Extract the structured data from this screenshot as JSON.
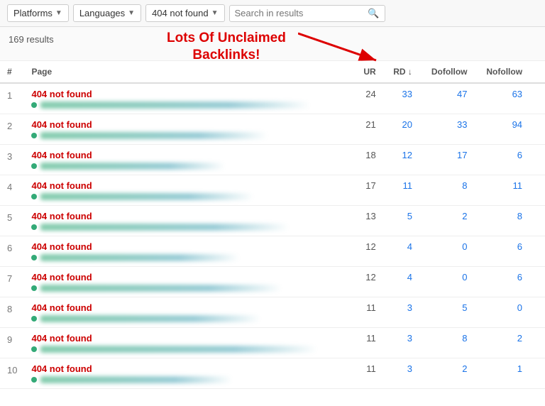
{
  "toolbar": {
    "platforms_label": "Platforms",
    "languages_label": "Languages",
    "filter_label": "404 not found",
    "search_placeholder": "Search in results"
  },
  "results": {
    "count": "169 results",
    "annotation_line1": "Lots Of Unclaimed",
    "annotation_line2": "Backlinks!"
  },
  "table": {
    "headers": [
      "#",
      "Page",
      "UR",
      "RD",
      "Dofollow",
      "Nofollow"
    ],
    "rows": [
      {
        "num": 1,
        "title": "404 not found",
        "url_blur": "long-url-domain.example.com/some-path/item-here.html",
        "ur": 24,
        "rd": 33,
        "dofollow": 47,
        "nofollow": 63
      },
      {
        "num": 2,
        "title": "404 not found",
        "url_blur": "another-domain.example.com/blah/blah/page.htm",
        "ur": 21,
        "rd": 20,
        "dofollow": 33,
        "nofollow": 94
      },
      {
        "num": 3,
        "title": "404 not found",
        "url_blur": "some-site.example.com/path/here",
        "ur": 18,
        "rd": 12,
        "dofollow": 17,
        "nofollow": 6
      },
      {
        "num": 4,
        "title": "404 not found",
        "url_blur": "example-website.com/long-sub-path/entry.html",
        "ur": 17,
        "rd": 11,
        "dofollow": 8,
        "nofollow": 11
      },
      {
        "num": 5,
        "title": "404 not found",
        "url_blur": "bigsite.example.com/category/article-name.html",
        "ur": 13,
        "rd": 5,
        "dofollow": 2,
        "nofollow": 8
      },
      {
        "num": 6,
        "title": "404 not found",
        "url_blur": "www.another-example.com/topic/sub/page",
        "ur": 12,
        "rd": 4,
        "dofollow": 0,
        "nofollow": 6
      },
      {
        "num": 7,
        "title": "404 not found",
        "url_blur": "resourcesite.com/long-path/subcategory/item.php",
        "ur": 12,
        "rd": 4,
        "dofollow": 0,
        "nofollow": 6
      },
      {
        "num": 8,
        "title": "404 not found",
        "url_blur": "platform.example.com/user/profile/content.html",
        "ur": 11,
        "rd": 3,
        "dofollow": 5,
        "nofollow": 0
      },
      {
        "num": 9,
        "title": "404 not found",
        "url_blur": "longdomain.example.com/very/long/url/path/here.html",
        "ur": 11,
        "rd": 3,
        "dofollow": 8,
        "nofollow": 2
      },
      {
        "num": 10,
        "title": "404 not found",
        "url_blur": "anothersite.example.com/sub/folder/file",
        "ur": 11,
        "rd": 3,
        "dofollow": 2,
        "nofollow": 1
      }
    ]
  }
}
